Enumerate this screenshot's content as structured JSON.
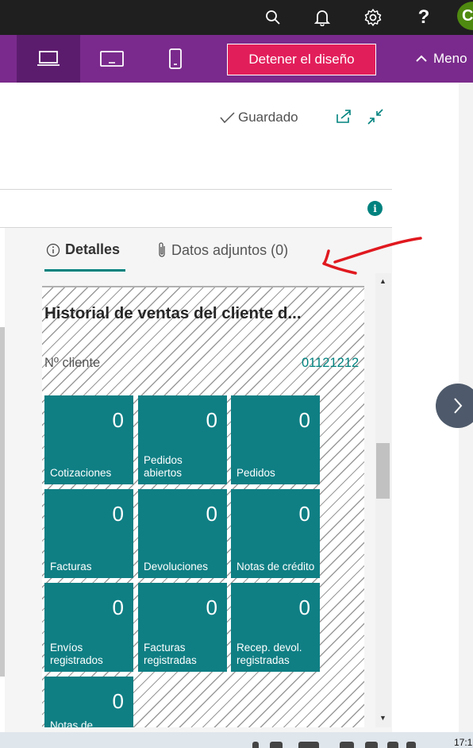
{
  "topbar": {
    "icons": [
      "search-icon",
      "bell-icon",
      "gear-icon",
      "help-icon"
    ],
    "help_label": "?",
    "avatar_initial": "C"
  },
  "design_bar": {
    "devices": [
      "desktop-icon",
      "tablet-icon",
      "phone-icon"
    ],
    "active_device": "desktop",
    "stop_design_label": "Detener el diseño",
    "menu_label": "Meno"
  },
  "header": {
    "saved_label": "Guardado",
    "icons": [
      "open-new-window-icon",
      "collapse-icon"
    ]
  },
  "factbox": {
    "tabs": [
      {
        "label": "Detalles",
        "icon": "info-icon",
        "active": true
      },
      {
        "label": "Datos adjuntos (0)",
        "icon": "paperclip-icon",
        "active": false
      }
    ],
    "part_title": "Historial de ventas del cliente d...",
    "customer_label": "Nº cliente",
    "customer_value": "01121212",
    "tiles": [
      {
        "value": "0",
        "label": "Cotizaciones"
      },
      {
        "value": "0",
        "label": "Pedidos abiertos"
      },
      {
        "value": "0",
        "label": "Pedidos"
      },
      {
        "value": "0",
        "label": "Facturas"
      },
      {
        "value": "0",
        "label": "Devoluciones"
      },
      {
        "value": "0",
        "label": "Notas de crédito"
      },
      {
        "value": "0",
        "label": "Envíos registrados"
      },
      {
        "value": "0",
        "label": "Facturas registradas"
      },
      {
        "value": "0",
        "label": "Recep. devol. registradas"
      },
      {
        "value": "0",
        "label": "Notas de"
      }
    ]
  },
  "taskbar": {
    "clock": "17:1"
  },
  "colors": {
    "design_bar": "#7a2a8c",
    "active_device": "#5c1c6e",
    "stop_button": "#e21e5a",
    "tile": "#0f7f84",
    "accent": "#00827f",
    "annotation_arrow": "#e0191f"
  }
}
